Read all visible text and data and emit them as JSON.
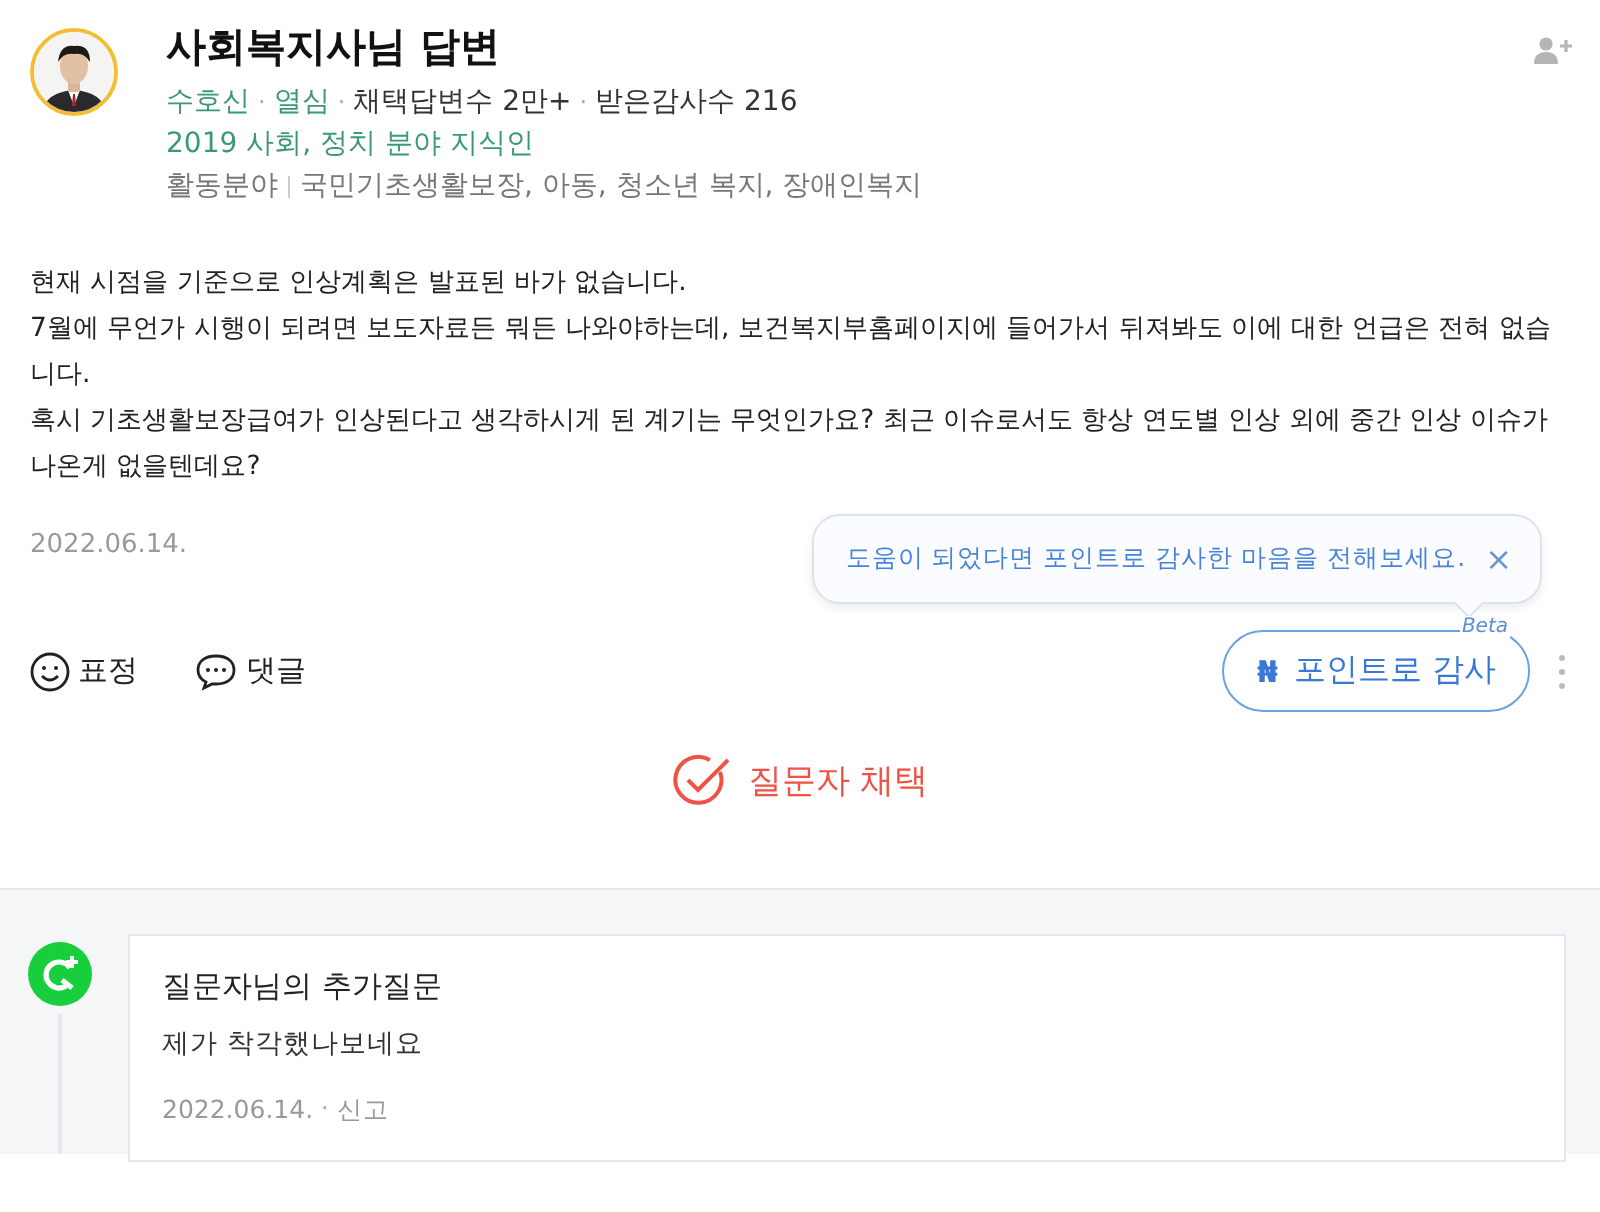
{
  "answer": {
    "title": "사회복지사님 답변",
    "stats": [
      {
        "text": "수호신",
        "kind": "badge"
      },
      {
        "text": "열심",
        "kind": "badge"
      },
      {
        "text": "채택답변수 2만+",
        "kind": "stat"
      },
      {
        "text": "받은감사수 216",
        "kind": "stat"
      }
    ],
    "separator": "·",
    "award": "2019 사회, 정치 분야 지식인",
    "field_label": "활동분야",
    "fields": "국민기초생활보장, 아동, 청소년 복지, 장애인복지",
    "paragraphs": [
      "현재 시점을 기준으로 인상계획은 발표된 바가 없습니다.",
      "7월에 무언가 시행이 되려면 보도자료든 뭐든 나와야하는데, 보건복지부홈페이지에 들어가서 뒤져봐도 이에 대한 언급은 전혀 없습니다.",
      "혹시 기초생활보장급여가 인상된다고 생각하시게 된 계기는 무엇인가요? 최근 이슈로서도 항상 연도별 인상 외에 중간 인상 이슈가 나온게 없을텐데요?"
    ],
    "date": "2022.06.14.",
    "tooltip": {
      "text": "도움이 되었다면 포인트로 감사한 마음을 전해보세요.",
      "close": "×"
    },
    "reaction": "표정",
    "comment": "댓글",
    "thanks": {
      "badge": "Beta",
      "icon": "₦",
      "label": "포인트로 감사"
    },
    "adopt": "질문자 채택"
  },
  "followup": {
    "title": "질문자님의 추가질문",
    "body": "제가 착각했나보네요",
    "date": "2022.06.14.",
    "separator": "·",
    "report": "신고"
  }
}
